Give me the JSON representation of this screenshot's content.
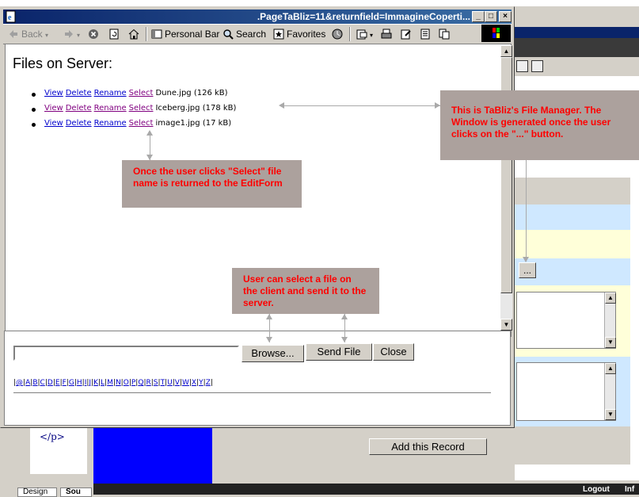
{
  "window": {
    "title": ".PageTaBliz=11&returnfield=ImmagineCoperti...",
    "buttons": {
      "minimize": "_",
      "maximize": "□",
      "close": "×"
    }
  },
  "toolbar": {
    "back": "Back",
    "personal_bar": "Personal Bar",
    "search": "Search",
    "favorites": "Favorites"
  },
  "content": {
    "heading": "Files on Server:",
    "action_labels": [
      "View",
      "Delete",
      "Rename",
      "Select"
    ],
    "files": [
      {
        "name": "Dune.jpg",
        "size": "(126 kB)"
      },
      {
        "name": "Iceberg.jpg",
        "size": "(178 kB)"
      },
      {
        "name": "image1.jpg",
        "size": "(17 kB)"
      }
    ]
  },
  "upload": {
    "file_value": "",
    "browse_label": "Browse...",
    "send_label": "Send File",
    "close_label": "Close"
  },
  "alpha_nav": [
    "@",
    "A",
    "B",
    "C",
    "D",
    "E",
    "F",
    "G",
    "H",
    "I",
    "J",
    "K",
    "L",
    "M",
    "N",
    "O",
    "P",
    "Q",
    "R",
    "S",
    "T",
    "U",
    "V",
    "W",
    "X",
    "Y",
    "Z"
  ],
  "callouts": {
    "select": "Once the user clicks \"Select\" file name is returned to the EditForm",
    "file_manager": "This is TaBliz's File Manager. The Window is generated once the user clicks on the \"...\" button.",
    "upload": "User can select a file on the client and send it to the server."
  },
  "background_app": {
    "dots_button": "...",
    "add_record_label": "Add this Record",
    "code_snippet": "</p>",
    "tabs": [
      "Design",
      "Sou"
    ],
    "status_links": [
      "Logout",
      "Inf"
    ]
  },
  "colors": {
    "callout_bg": "#aca19d",
    "callout_text": "#ff0000",
    "link": "#0000cc",
    "link_visited": "#800080",
    "titlebar": "#0a246a"
  }
}
